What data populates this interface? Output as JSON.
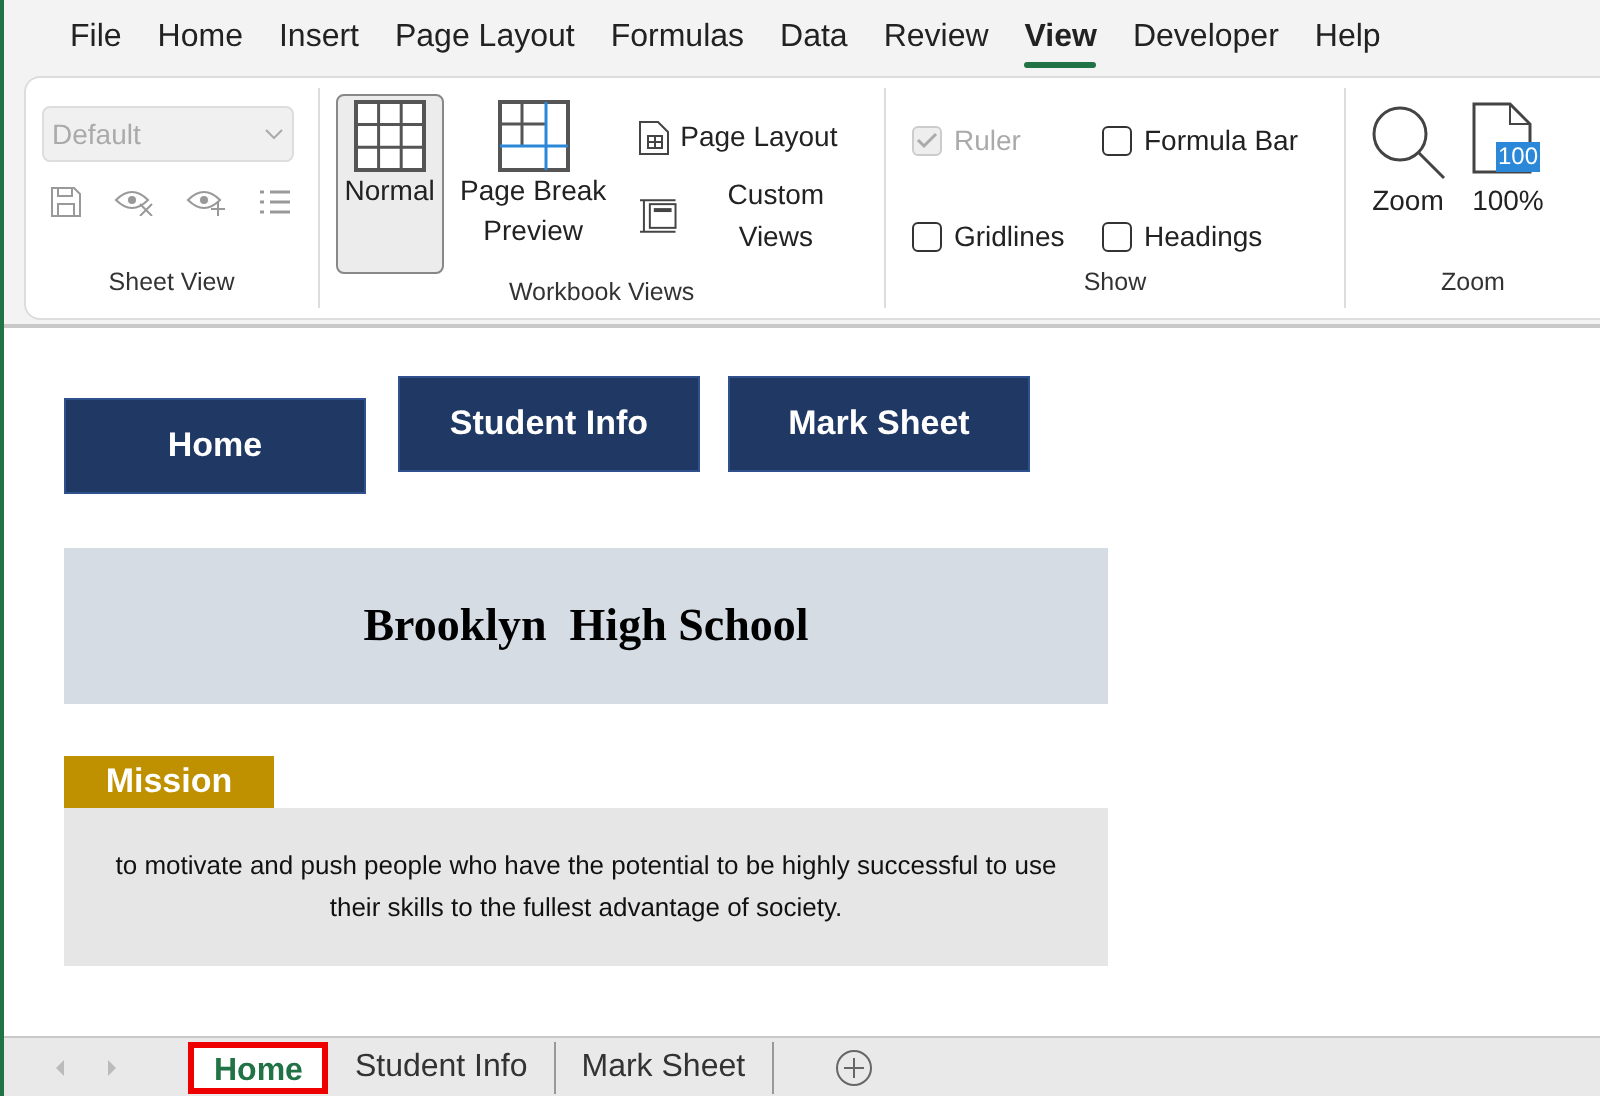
{
  "menu_tabs": [
    {
      "label": "File",
      "selected": false
    },
    {
      "label": "Home",
      "selected": false
    },
    {
      "label": "Insert",
      "selected": false
    },
    {
      "label": "Page Layout",
      "selected": false
    },
    {
      "label": "Formulas",
      "selected": false
    },
    {
      "label": "Data",
      "selected": false
    },
    {
      "label": "Review",
      "selected": false
    },
    {
      "label": "View",
      "selected": true
    },
    {
      "label": "Developer",
      "selected": false
    },
    {
      "label": "Help",
      "selected": false
    }
  ],
  "ribbon": {
    "sheet_view": {
      "label": "Sheet View",
      "dropdown": {
        "value": "Default",
        "disabled": true
      }
    },
    "workbook_views": {
      "label": "Workbook Views",
      "buttons": [
        {
          "kind": "large",
          "label": "Normal",
          "selected": true
        },
        {
          "kind": "large",
          "label": "Page Break Preview",
          "selected": false
        },
        {
          "kind": "small",
          "label": "Page Layout"
        },
        {
          "kind": "small",
          "label": "Custom Views"
        }
      ]
    },
    "show": {
      "label": "Show",
      "checkboxes": [
        {
          "label": "Ruler",
          "checked": true,
          "disabled": true
        },
        {
          "label": "Formula Bar",
          "checked": false,
          "disabled": false
        },
        {
          "label": "Gridlines",
          "checked": false,
          "disabled": false
        },
        {
          "label": "Headings",
          "checked": false,
          "disabled": false
        }
      ]
    },
    "zoom": {
      "label": "Zoom",
      "buttons": [
        {
          "kind": "magnifier",
          "label": "Zoom"
        },
        {
          "kind": "page",
          "label": "100%",
          "badge": "100"
        }
      ]
    }
  },
  "sheet": {
    "nav_buttons": [
      {
        "label": "Home"
      },
      {
        "label": "Student Info"
      },
      {
        "label": "Mark Sheet"
      }
    ],
    "title": "Brooklyn  High School",
    "mission": {
      "heading": "Mission",
      "text": "to motivate and push people who have the potential to be highly successful to use their skills to the fullest advantage of society."
    }
  },
  "sheet_tabs": [
    {
      "label": "Home",
      "selected": true
    },
    {
      "label": "Student Info",
      "selected": false
    },
    {
      "label": "Mark Sheet",
      "selected": false
    }
  ]
}
